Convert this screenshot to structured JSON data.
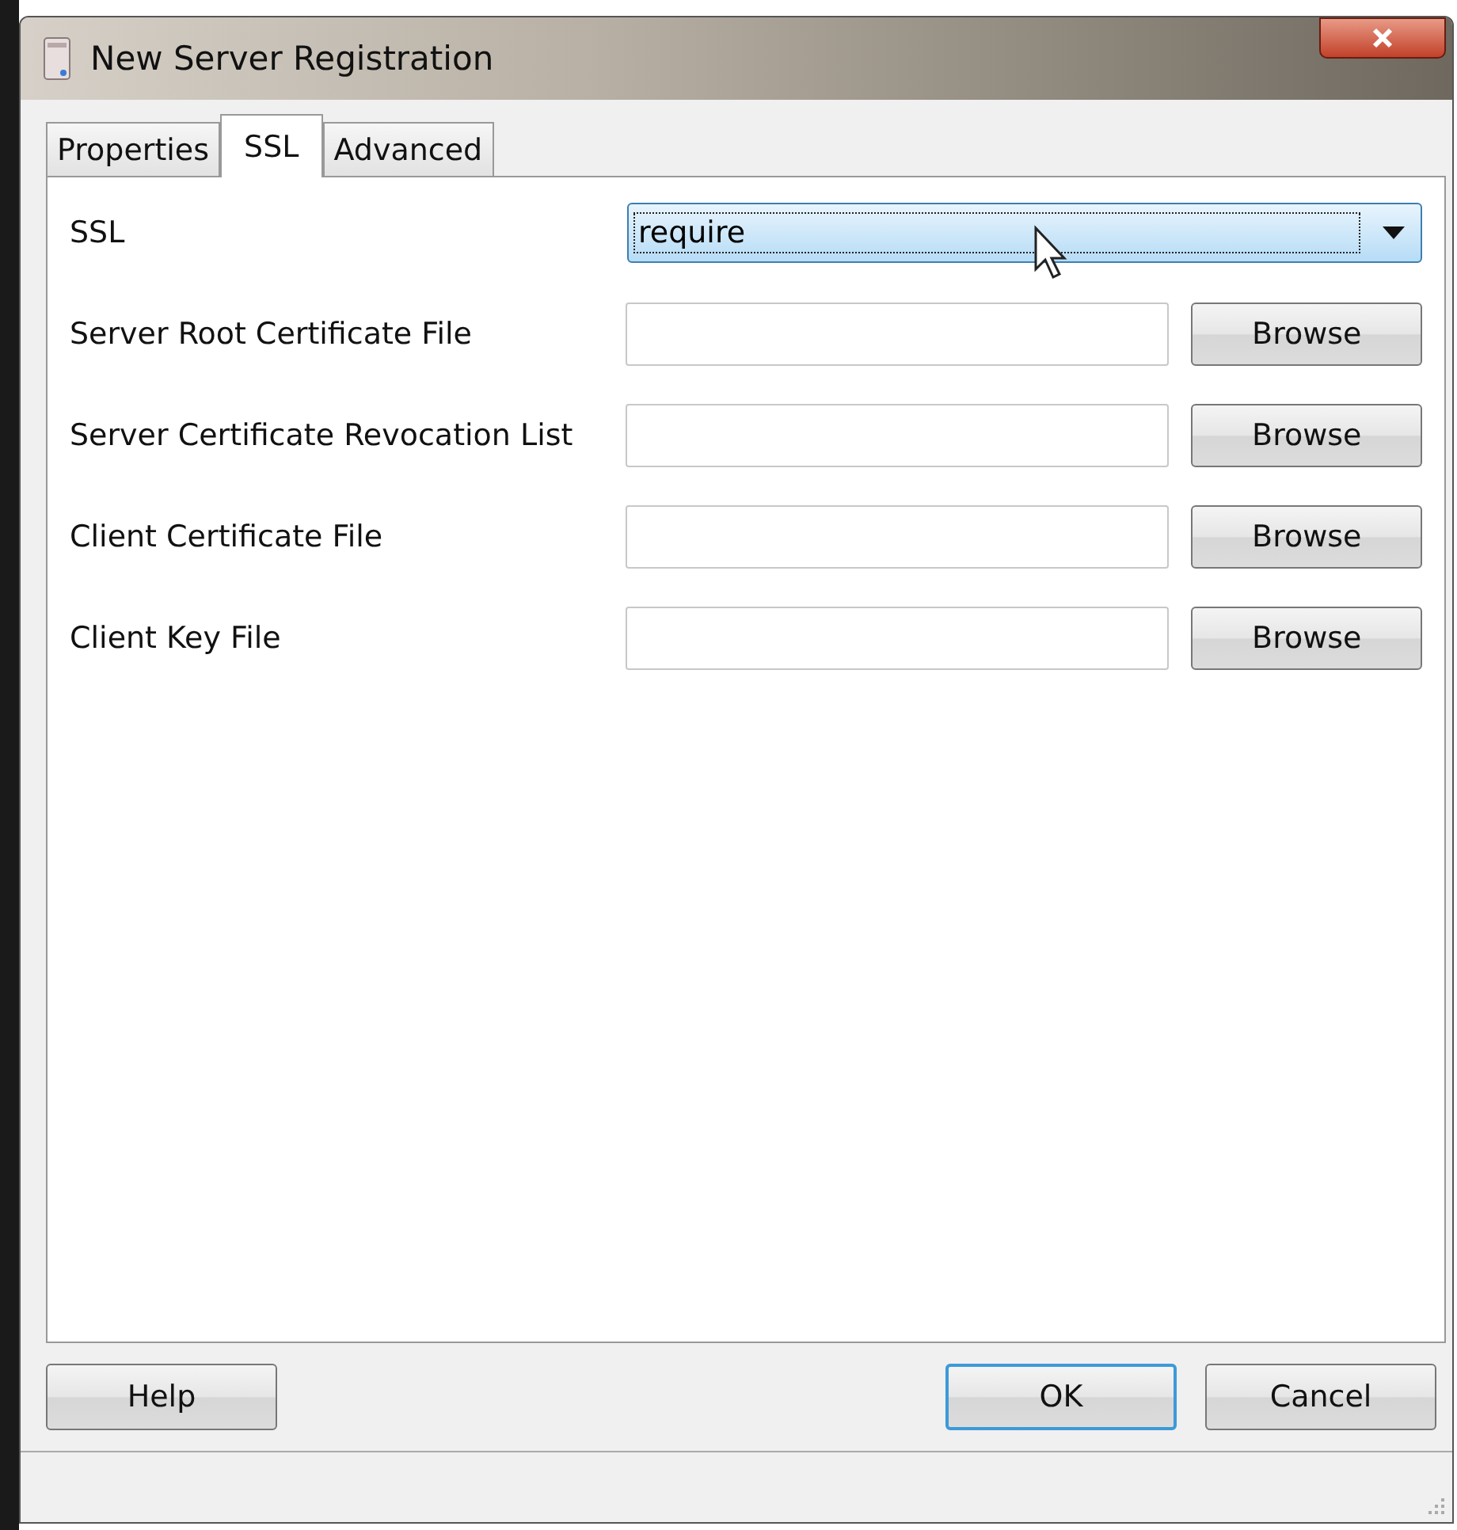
{
  "window": {
    "title": "New Server Registration"
  },
  "tabs": [
    {
      "label": "Properties",
      "selected": false
    },
    {
      "label": "SSL",
      "selected": true
    },
    {
      "label": "Advanced",
      "selected": false
    }
  ],
  "fields": [
    {
      "kind": "select",
      "label": "SSL",
      "value": "require"
    },
    {
      "kind": "file",
      "label": "Server Root Certificate File",
      "button": "Browse"
    },
    {
      "kind": "file",
      "label": "Server Certificate Revocation List",
      "button": "Browse"
    },
    {
      "kind": "file",
      "label": "Client Certificate File",
      "button": "Browse"
    },
    {
      "kind": "file",
      "label": "Client Key File",
      "button": "Browse"
    }
  ],
  "buttons": [
    {
      "label": "Help",
      "default": false
    },
    {
      "label": "OK",
      "default": true
    },
    {
      "label": "Cancel",
      "default": false
    }
  ]
}
